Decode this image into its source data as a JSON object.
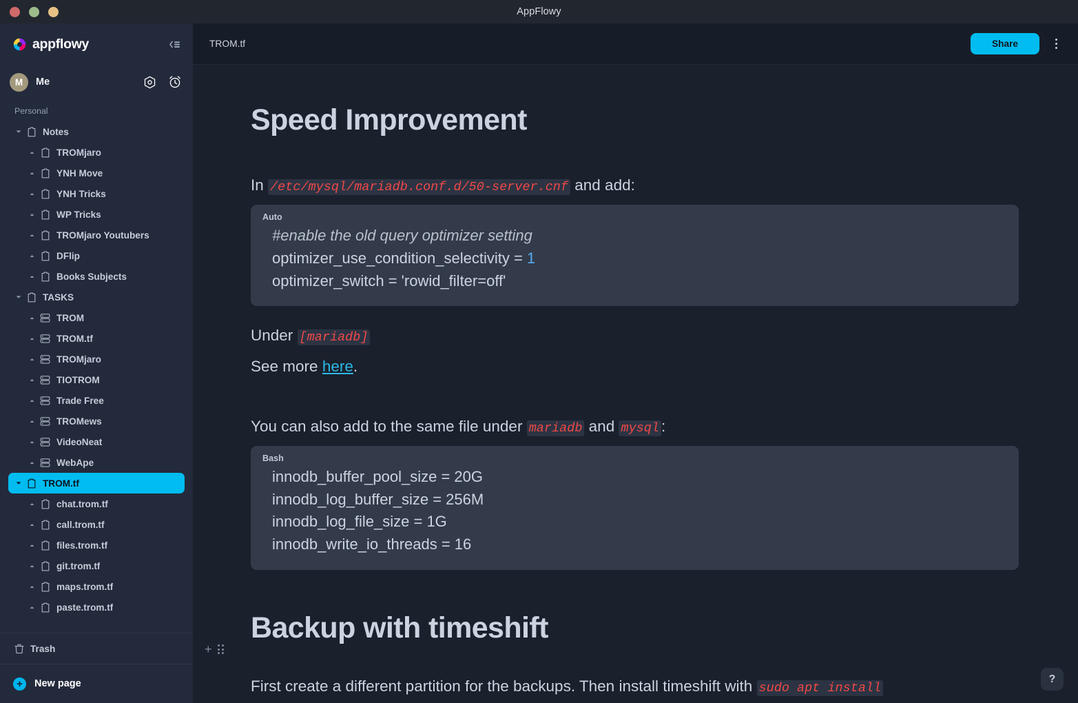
{
  "window": {
    "title": "AppFlowy",
    "controls": [
      "close",
      "minimize",
      "maximize"
    ]
  },
  "sidebar": {
    "brand": "appflowy",
    "collapse_icon": "collapse-sidebar-icon",
    "user": {
      "avatar_initial": "M",
      "name": "Me",
      "settings_icon": "settings-icon",
      "clock_icon": "alarm-clock-icon"
    },
    "section_label": "Personal",
    "tree": [
      {
        "label": "Notes",
        "level": 0,
        "icon": "document-icon",
        "expanded": true,
        "selected": false
      },
      {
        "label": "TROMjaro",
        "level": 1,
        "icon": "document-icon",
        "expanded": false,
        "selected": false
      },
      {
        "label": "YNH Move",
        "level": 1,
        "icon": "document-icon",
        "expanded": false,
        "selected": false
      },
      {
        "label": "YNH Tricks",
        "level": 1,
        "icon": "document-icon",
        "expanded": false,
        "selected": false
      },
      {
        "label": "WP Tricks",
        "level": 1,
        "icon": "document-icon",
        "expanded": false,
        "selected": false
      },
      {
        "label": "TROMjaro Youtubers",
        "level": 1,
        "icon": "document-icon",
        "expanded": false,
        "selected": false
      },
      {
        "label": "DFlip",
        "level": 1,
        "icon": "document-icon",
        "expanded": false,
        "selected": false
      },
      {
        "label": "Books Subjects",
        "level": 1,
        "icon": "document-icon",
        "expanded": false,
        "selected": false
      },
      {
        "label": "TASKS",
        "level": 0,
        "icon": "document-icon",
        "expanded": true,
        "selected": false
      },
      {
        "label": "TROM",
        "level": 1,
        "icon": "grid-database-icon",
        "expanded": false,
        "selected": false
      },
      {
        "label": "TROM.tf",
        "level": 1,
        "icon": "grid-database-icon",
        "expanded": false,
        "selected": false
      },
      {
        "label": "TROMjaro",
        "level": 1,
        "icon": "grid-database-icon",
        "expanded": false,
        "selected": false
      },
      {
        "label": "TIOTROM",
        "level": 1,
        "icon": "grid-database-icon",
        "expanded": false,
        "selected": false
      },
      {
        "label": "Trade Free",
        "level": 1,
        "icon": "grid-database-icon",
        "expanded": false,
        "selected": false
      },
      {
        "label": "TROMews",
        "level": 1,
        "icon": "grid-database-icon",
        "expanded": false,
        "selected": false
      },
      {
        "label": "VideoNeat",
        "level": 1,
        "icon": "grid-database-icon",
        "expanded": false,
        "selected": false
      },
      {
        "label": "WebApe",
        "level": 1,
        "icon": "grid-database-icon",
        "expanded": false,
        "selected": false
      },
      {
        "label": "TROM.tf",
        "level": 0,
        "icon": "document-icon",
        "expanded": true,
        "selected": true
      },
      {
        "label": "chat.trom.tf",
        "level": 1,
        "icon": "document-icon",
        "expanded": false,
        "selected": false
      },
      {
        "label": "call.trom.tf",
        "level": 1,
        "icon": "document-icon",
        "expanded": false,
        "selected": false
      },
      {
        "label": "files.trom.tf",
        "level": 1,
        "icon": "document-icon",
        "expanded": false,
        "selected": false
      },
      {
        "label": "git.trom.tf",
        "level": 1,
        "icon": "document-icon",
        "expanded": false,
        "selected": false
      },
      {
        "label": "maps.trom.tf",
        "level": 1,
        "icon": "document-icon",
        "expanded": false,
        "selected": false
      },
      {
        "label": "paste.trom.tf",
        "level": 1,
        "icon": "document-icon",
        "expanded": false,
        "selected": false
      }
    ],
    "trash": {
      "label": "Trash",
      "icon": "trash-icon"
    },
    "new_page": {
      "label": "New page",
      "icon": "plus-circle-icon"
    }
  },
  "topbar": {
    "breadcrumb": "TROM.tf",
    "share_label": "Share",
    "more_icon": "more-vertical-icon"
  },
  "document": {
    "heading1": "Speed Improvement",
    "para1": {
      "pre": "In ",
      "code": "/etc/mysql/mariadb.conf.d/50-server.cnf",
      "post": " and add:"
    },
    "code1": {
      "lang": "Auto",
      "lines": [
        {
          "comment": "#enable the old query optimizer setting"
        },
        {
          "text": "optimizer_use_condition_selectivity = ",
          "number": "1"
        },
        {
          "text": "optimizer_switch = 'rowid_filter=off'"
        }
      ]
    },
    "para2": {
      "pre": "Under ",
      "code": "[mariadb]",
      "post": ""
    },
    "para3": {
      "pre": "See more ",
      "link": "here",
      "post": "."
    },
    "para4": {
      "pre": "You can also add to the same file under ",
      "code1": "mariadb",
      "mid": " and ",
      "code2": "mysql",
      "post": ":"
    },
    "code2": {
      "lang": "Bash",
      "lines": [
        {
          "text": "innodb_buffer_pool_size = 20G"
        },
        {
          "text": "innodb_log_buffer_size = 256M"
        },
        {
          "text": "innodb_log_file_size = 1G"
        },
        {
          "text": "innodb_write_io_threads = 16"
        }
      ]
    },
    "block_handles": {
      "add_icon": "plus-icon",
      "drag_icon": "drag-handle-icon"
    },
    "heading2": "Backup with timeshift",
    "para5": {
      "pre": "First create a different partition for the backups. Then install timeshift with ",
      "code": "sudo apt install",
      "post": ""
    },
    "help_label": "?"
  },
  "colors": {
    "accent": "#00bcf0",
    "sidebar_bg": "#232a3b",
    "main_bg": "#1a202c",
    "topbar_bg": "#171d28",
    "code_bg": "#333b4a",
    "inline_code": "#f04848",
    "link": "#2cb8e8",
    "text": "#ccd3e0"
  }
}
